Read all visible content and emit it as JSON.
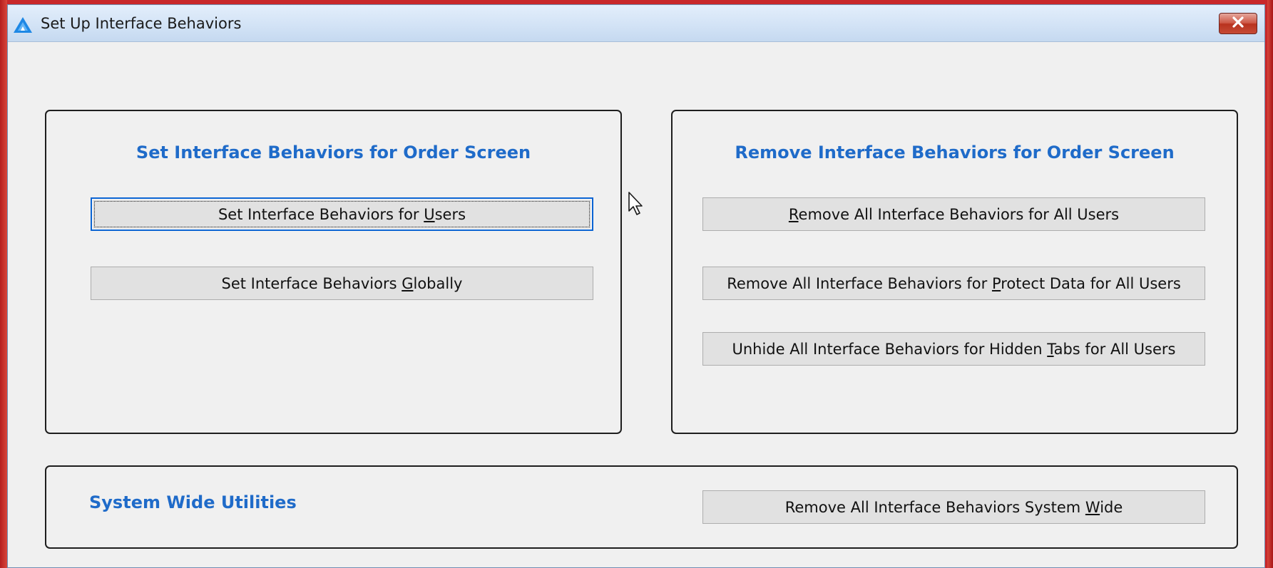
{
  "window": {
    "title": "Set Up Interface Behaviors"
  },
  "set_group": {
    "title": "Set Interface Behaviors for Order Screen",
    "buttons": [
      {
        "pre": "Set Interface Behaviors for ",
        "key": "U",
        "post": "sers",
        "focused": true
      },
      {
        "pre": "Set Interface Behaviors ",
        "key": "G",
        "post": "lobally",
        "focused": false
      }
    ]
  },
  "remove_group": {
    "title": "Remove Interface Behaviors for Order Screen",
    "buttons": [
      {
        "pre": "",
        "key": "R",
        "post": "emove All Interface Behaviors for All Users"
      },
      {
        "pre": "Remove All Interface Behaviors for ",
        "key": "P",
        "post": "rotect Data for All Users"
      },
      {
        "pre": "Unhide All Interface Behaviors for Hidden ",
        "key": "T",
        "post": "abs for All Users"
      }
    ]
  },
  "system_group": {
    "title": "System Wide Utilities",
    "button": {
      "pre": "Remove All Interface Behaviors System ",
      "key": "W",
      "post": "ide"
    }
  },
  "colors": {
    "group_title": "#1f6bc9",
    "focus_border": "#0a63d2",
    "close_button": "#c64a35"
  },
  "icons": {
    "app": "app-logo-triangle-icon",
    "close": "close-icon",
    "cursor": "mouse-pointer-icon"
  }
}
